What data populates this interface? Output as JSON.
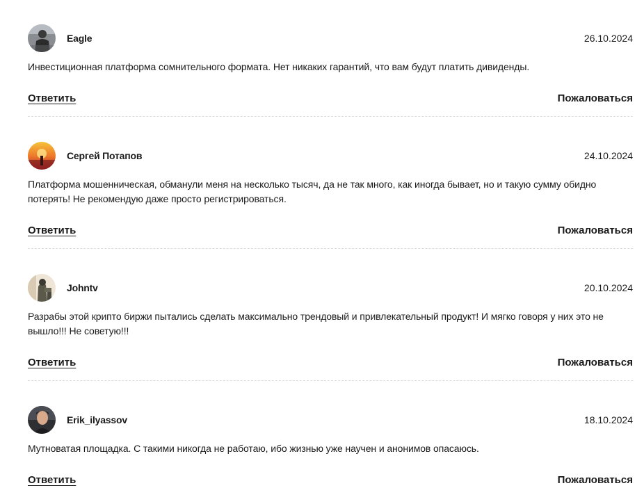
{
  "actions": {
    "reply_label": "Ответить",
    "report_label": "Пожаловаться"
  },
  "comments": [
    {
      "author": "Eagle",
      "date": "26.10.2024",
      "text": "Инвестиционная платформа сомнительного формата. Нет никаких гарантий, что вам будут платить дивиденды."
    },
    {
      "author": "Сергей Потапов",
      "date": "24.10.2024",
      "text": "Платформа мошенническая, обманули меня на несколько тысяч, да не так много, как иногда бывает, но и такую сумму обидно потерять! Не рекомендую даже просто регистрироваться."
    },
    {
      "author": "Johntv",
      "date": "20.10.2024",
      "text": "Разрабы этой крипто биржи пытались сделать максимально трендовый и привлекательный продукт! И мягко говоря у них это не вышло!!! Не советую!!!"
    },
    {
      "author": "Erik_ilyassov",
      "date": "18.10.2024",
      "text": "Мутноватая площадка. С такими никогда не работаю, ибо жизнью уже научен и анонимов опасаюсь."
    }
  ]
}
